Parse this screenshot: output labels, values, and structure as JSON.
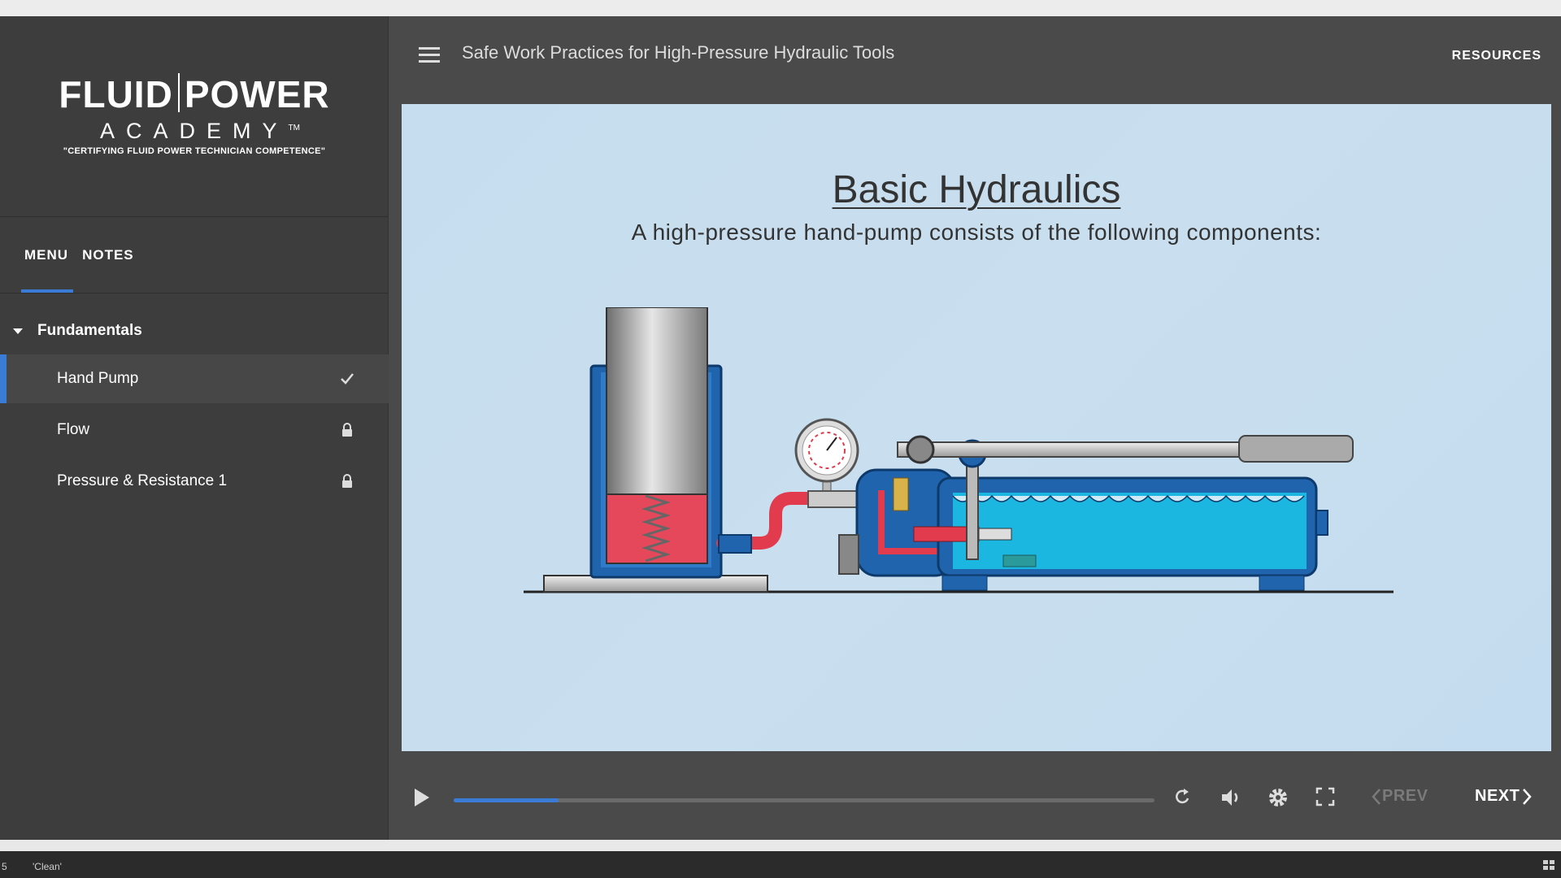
{
  "header": {
    "course_title": "Safe Work Practices for High-Pressure Hydraulic Tools",
    "resources_label": "RESOURCES"
  },
  "logo": {
    "line1_left": "FLUID",
    "line1_right": "POWER",
    "line2": "ACADEMY",
    "trademark": "TM",
    "tagline": "\"CERTIFYING FLUID POWER TECHNICIAN COMPETENCE\""
  },
  "sidebar": {
    "tabs": [
      {
        "label": "MENU",
        "active": true
      },
      {
        "label": "NOTES",
        "active": false
      }
    ],
    "section": {
      "label": "Fundamentals",
      "expanded": true
    },
    "lessons": [
      {
        "label": "Hand Pump",
        "status": "completed",
        "status_icon": "check-icon"
      },
      {
        "label": "Flow",
        "status": "locked",
        "status_icon": "lock-icon"
      },
      {
        "label": "Pressure & Resistance 1",
        "status": "locked",
        "status_icon": "lock-icon"
      }
    ]
  },
  "slide": {
    "title": "Basic Hydraulics",
    "subtitle": "A high-pressure hand-pump consists of the following components:"
  },
  "player": {
    "progress_fraction": 0.15,
    "prev_label": "PREV",
    "next_label": "NEXT",
    "accent_color": "#3a7bd5"
  },
  "statusbar": {
    "left_text": "5",
    "middle_text": "'Clean'"
  }
}
